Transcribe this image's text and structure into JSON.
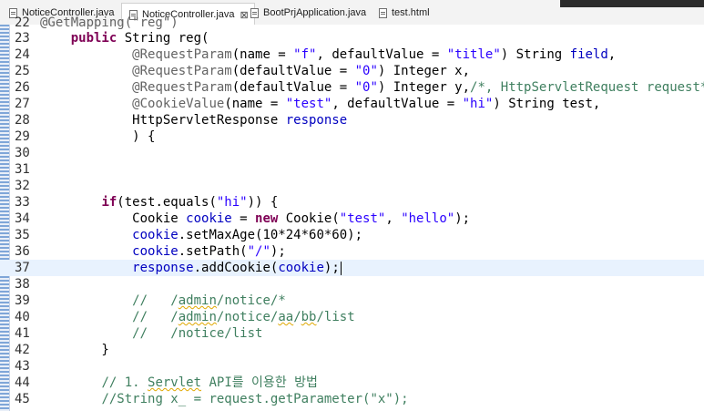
{
  "tabs": [
    {
      "label": "NoticeController.java",
      "active": false
    },
    {
      "label": "NoticeController.java",
      "active": true,
      "close": "⊠"
    },
    {
      "label": "BootPrjApplication.java",
      "active": false
    },
    {
      "label": "test.html",
      "active": false
    }
  ],
  "editor": {
    "cut_line": {
      "number": "22",
      "text": "@GetMapping(\"reg\")"
    },
    "lines": [
      {
        "n": "23",
        "tokens": [
          {
            "t": "    "
          },
          {
            "t": "public",
            "c": "kw"
          },
          {
            "t": " String reg("
          }
        ]
      },
      {
        "n": "24",
        "tokens": [
          {
            "t": "            "
          },
          {
            "t": "@RequestParam",
            "c": "ann"
          },
          {
            "t": "(name = "
          },
          {
            "t": "\"f\"",
            "c": "str"
          },
          {
            "t": ", defaultValue = "
          },
          {
            "t": "\"title\"",
            "c": "str"
          },
          {
            "t": ") String "
          },
          {
            "t": "field",
            "c": "fld"
          },
          {
            "t": ","
          }
        ]
      },
      {
        "n": "25",
        "tokens": [
          {
            "t": "            "
          },
          {
            "t": "@RequestParam",
            "c": "ann"
          },
          {
            "t": "(defaultValue = "
          },
          {
            "t": "\"0\"",
            "c": "str"
          },
          {
            "t": ") Integer x,"
          }
        ]
      },
      {
        "n": "26",
        "tokens": [
          {
            "t": "            "
          },
          {
            "t": "@RequestParam",
            "c": "ann"
          },
          {
            "t": "(defaultValue = "
          },
          {
            "t": "\"0\"",
            "c": "str"
          },
          {
            "t": ") Integer y,"
          },
          {
            "t": "/*, HttpServletRequest request*/",
            "c": "cmt"
          }
        ]
      },
      {
        "n": "27",
        "tokens": [
          {
            "t": "            "
          },
          {
            "t": "@CookieValue",
            "c": "ann"
          },
          {
            "t": "(name = "
          },
          {
            "t": "\"test\"",
            "c": "str"
          },
          {
            "t": ", defaultValue = "
          },
          {
            "t": "\"hi\"",
            "c": "str"
          },
          {
            "t": ") String test,"
          }
        ]
      },
      {
        "n": "28",
        "tokens": [
          {
            "t": "            HttpServletResponse "
          },
          {
            "t": "response",
            "c": "fld"
          }
        ]
      },
      {
        "n": "29",
        "tokens": [
          {
            "t": "            ) {"
          }
        ]
      },
      {
        "n": "30",
        "tokens": []
      },
      {
        "n": "31",
        "tokens": []
      },
      {
        "n": "32",
        "tokens": []
      },
      {
        "n": "33",
        "tokens": [
          {
            "t": "        "
          },
          {
            "t": "if",
            "c": "kw"
          },
          {
            "t": "(test.equals("
          },
          {
            "t": "\"hi\"",
            "c": "str"
          },
          {
            "t": ")) {"
          }
        ]
      },
      {
        "n": "34",
        "tokens": [
          {
            "t": "            Cookie "
          },
          {
            "t": "cookie",
            "c": "fld"
          },
          {
            "t": " = "
          },
          {
            "t": "new",
            "c": "kw"
          },
          {
            "t": " Cookie("
          },
          {
            "t": "\"test\"",
            "c": "str"
          },
          {
            "t": ", "
          },
          {
            "t": "\"hello\"",
            "c": "str"
          },
          {
            "t": ");"
          }
        ]
      },
      {
        "n": "35",
        "tokens": [
          {
            "t": "            "
          },
          {
            "t": "cookie",
            "c": "fld"
          },
          {
            "t": ".setMaxAge(10*24*60*60);"
          }
        ]
      },
      {
        "n": "36",
        "tokens": [
          {
            "t": "            "
          },
          {
            "t": "cookie",
            "c": "fld"
          },
          {
            "t": ".setPath("
          },
          {
            "t": "\"/\"",
            "c": "str"
          },
          {
            "t": ");"
          }
        ]
      },
      {
        "n": "37",
        "current": true,
        "caret": true,
        "tokens": [
          {
            "t": "            "
          },
          {
            "t": "response",
            "c": "fld"
          },
          {
            "t": ".addCookie("
          },
          {
            "t": "cookie",
            "c": "fld"
          },
          {
            "t": ");"
          }
        ]
      },
      {
        "n": "38",
        "tokens": []
      },
      {
        "n": "39",
        "tokens": [
          {
            "t": "            "
          },
          {
            "t": "//   /",
            "c": "cmt"
          },
          {
            "t": "admin",
            "c": "cmt squig"
          },
          {
            "t": "/notice/*",
            "c": "cmt"
          }
        ]
      },
      {
        "n": "40",
        "tokens": [
          {
            "t": "            "
          },
          {
            "t": "//   /",
            "c": "cmt"
          },
          {
            "t": "admin",
            "c": "cmt squig"
          },
          {
            "t": "/notice/",
            "c": "cmt"
          },
          {
            "t": "aa",
            "c": "cmt squig"
          },
          {
            "t": "/",
            "c": "cmt"
          },
          {
            "t": "bb",
            "c": "cmt squig"
          },
          {
            "t": "/list",
            "c": "cmt"
          }
        ]
      },
      {
        "n": "41",
        "tokens": [
          {
            "t": "            "
          },
          {
            "t": "//   /notice/list",
            "c": "cmt"
          }
        ]
      },
      {
        "n": "42",
        "tokens": [
          {
            "t": "        }"
          }
        ]
      },
      {
        "n": "43",
        "tokens": []
      },
      {
        "n": "44",
        "tokens": [
          {
            "t": "        "
          },
          {
            "t": "// 1. ",
            "c": "cmt"
          },
          {
            "t": "Servlet",
            "c": "cmt squig"
          },
          {
            "t": " API를 이용한 방법",
            "c": "cmt"
          }
        ]
      },
      {
        "n": "45",
        "tokens": [
          {
            "t": "        "
          },
          {
            "t": "//String x_ = request.getParameter(\"x\");",
            "c": "cmt"
          }
        ]
      }
    ]
  }
}
